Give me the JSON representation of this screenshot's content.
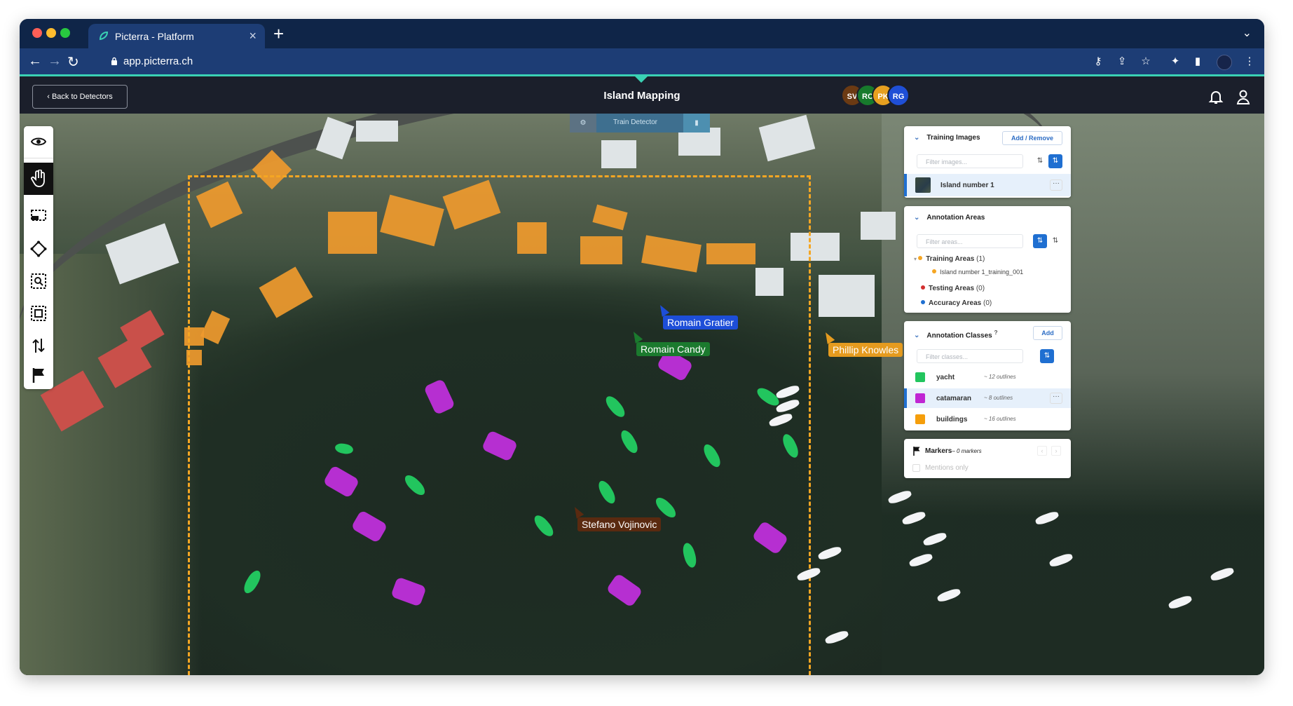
{
  "browser": {
    "tab_title": "Picterra - Platform",
    "new_tab": "+",
    "url": "app.picterra.ch"
  },
  "header": {
    "back_label": "‹ Back to Detectors",
    "title": "Island Mapping",
    "avatars": [
      {
        "initials": "SV",
        "color": "#6b3a13"
      },
      {
        "initials": "RC",
        "color": "#177a2c"
      },
      {
        "initials": "PK",
        "color": "#e7a020"
      },
      {
        "initials": "RG",
        "color": "#1f4fd6"
      }
    ]
  },
  "train": {
    "label": "Train Detector"
  },
  "cursors": [
    {
      "name": "Romain Gratier",
      "color": "#1d4ed8"
    },
    {
      "name": "Romain Candy",
      "color": "#1b7a2e"
    },
    {
      "name": "Phillip Knowles",
      "color": "#e59b1f"
    },
    {
      "name": "Stefano Vojinovic",
      "color": "#5a2a10"
    }
  ],
  "training_images": {
    "title": "Training Images",
    "add_label": "Add / Remove",
    "filter_placeholder": "Filter images...",
    "items": [
      {
        "label": "Island number 1"
      }
    ]
  },
  "annotation_areas": {
    "title": "Annotation Areas",
    "filter_placeholder": "Filter areas...",
    "training": {
      "label": "Training Areas",
      "count": "(1)",
      "color": "#f5a623"
    },
    "training_child": "Island number 1_training_001",
    "testing": {
      "label": "Testing Areas",
      "count": "(0)",
      "color": "#d32f2f"
    },
    "accuracy": {
      "label": "Accuracy Areas",
      "count": "(0)",
      "color": "#1f6fd1"
    }
  },
  "annotation_classes": {
    "title": "Annotation Classes",
    "help": "?",
    "add_label": "Add",
    "filter_placeholder": "Filter classes...",
    "items": [
      {
        "name": "yacht",
        "count": "~ 12 outlines",
        "color": "#22c55e"
      },
      {
        "name": "catamaran",
        "count": "~ 8 outlines",
        "color": "#c026d3"
      },
      {
        "name": "buildings",
        "count": "~ 16 outlines",
        "color": "#f59e0b"
      }
    ]
  },
  "markers": {
    "title": "Markers",
    "count": "– 0 markers",
    "mentions_label": "Mentions only"
  }
}
